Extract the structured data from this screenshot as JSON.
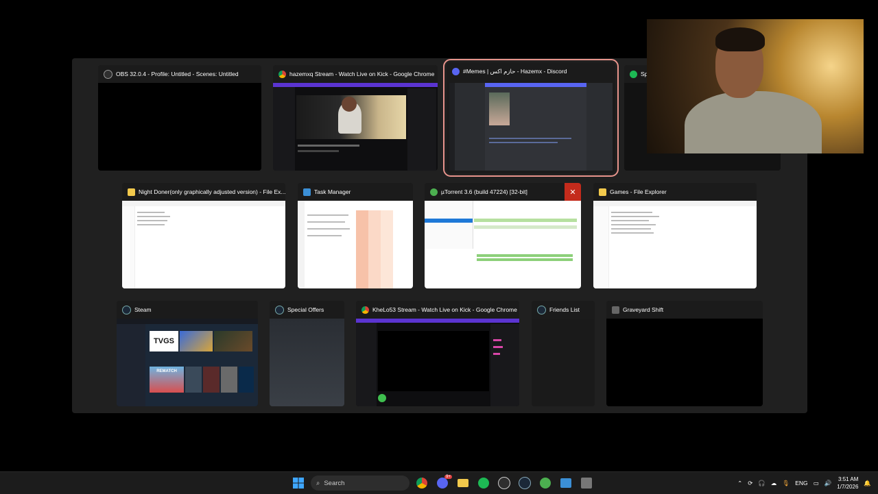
{
  "switcher": {
    "windows": [
      {
        "title": "OBS 32.0.4 - Profile: Untitled - Scenes: Untitled",
        "icon": "obs-icon",
        "icon_color": "#2f2f2f"
      },
      {
        "title": "hazemxq Stream - Watch Live on Kick - Google Chrome",
        "icon": "chrome-icon",
        "icon_color": "#e8a23b"
      },
      {
        "title": "#Memes | حازم اكس - Hazemx - Discord",
        "icon": "discord-icon",
        "icon_color": "#5865f2"
      },
      {
        "title": "Sp",
        "icon": "spotify-icon",
        "icon_color": "#1db954"
      },
      {
        "title": "Night Doner(only graphically adjusted version) - File Ex...",
        "icon": "folder-icon",
        "icon_color": "#f2c94c"
      },
      {
        "title": "Task Manager",
        "icon": "task-manager-icon",
        "icon_color": "#3b8fd6"
      },
      {
        "title": "µTorrent 3.6  (build 47224) [32-bit]",
        "icon": "utorrent-icon",
        "icon_color": "#4caf50"
      },
      {
        "title": "Games - File Explorer",
        "icon": "folder-icon",
        "icon_color": "#f2c94c"
      },
      {
        "title": "Steam",
        "icon": "steam-icon",
        "icon_color": "#1b2838"
      },
      {
        "title": "Special Offers",
        "icon": "steam-icon",
        "icon_color": "#1b2838"
      },
      {
        "title": "KheLo53 Stream - Watch Live on Kick - Google Chrome",
        "icon": "chrome-icon",
        "icon_color": "#e8a23b"
      },
      {
        "title": "Friends List",
        "icon": "steam-icon",
        "icon_color": "#1b2838"
      },
      {
        "title": "Graveyard Shift",
        "icon": "game-icon",
        "icon_color": "#666666"
      }
    ],
    "steam_banner": {
      "tvgs": "TVGS",
      "rematch": "REMATCH"
    }
  },
  "taskbar": {
    "search_placeholder": "Search",
    "language": "ENG",
    "time": "3:51 AM",
    "date": "1/7/2026",
    "discord_badge": "9+"
  }
}
